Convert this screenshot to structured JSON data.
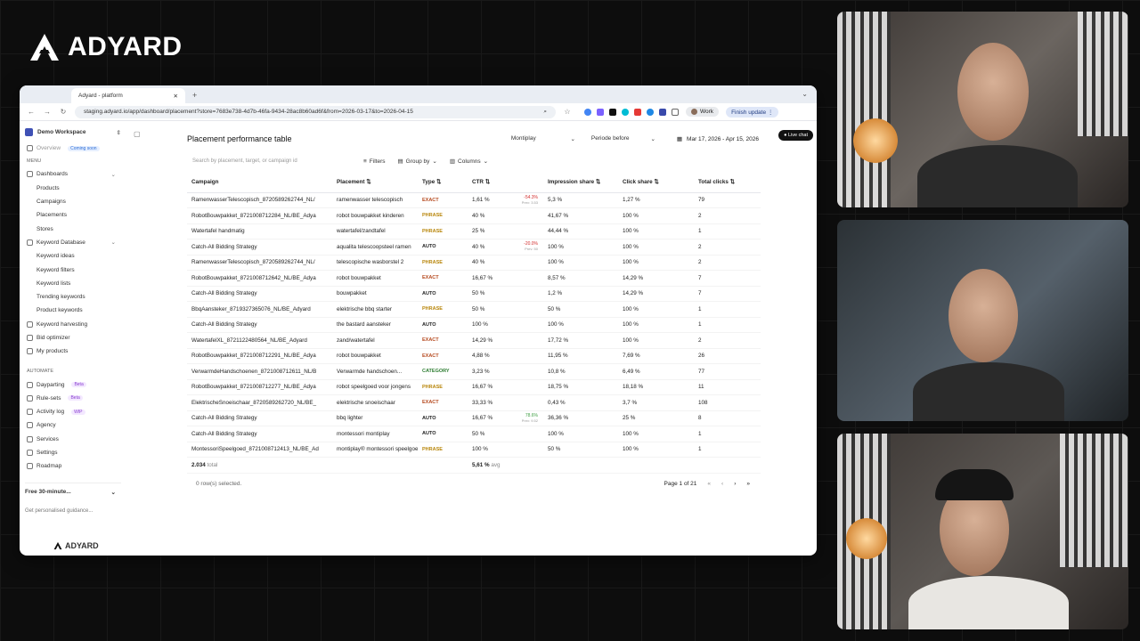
{
  "brand": {
    "name": "ADYARD"
  },
  "browser": {
    "tab_title": "Adyard - platform",
    "url": "staging.adyard.io/app/dashboard/placement?store=7683e738-4d7b-46fa-9434-28ac8b60ad6f&from=2026-03-17&to=2026-04-15",
    "profile_label": "Work",
    "finish_label": "Finish update"
  },
  "sidebar": {
    "workspace": "Demo Workspace",
    "overview": "Overview",
    "overview_badge": "Coming soon",
    "menu_title": "MENU",
    "dashboards": "Dashboards",
    "dashboard_items": [
      "Products",
      "Campaigns",
      "Placements",
      "Stores"
    ],
    "keyword_database": "Keyword Database",
    "keyword_items": [
      "Keyword ideas",
      "Keyword filters",
      "Keyword lists",
      "Trending keywords",
      "Product keywords"
    ],
    "keyword_harvesting": "Keyword harvesting",
    "bid_optimizer": "Bid optimizer",
    "my_products": "My products",
    "automate_title": "AUTOMATE",
    "dayparting": "Dayparting",
    "dayparting_badge": "Beta",
    "rule_sets": "Rule-sets",
    "rule_sets_badge": "Beta",
    "activity_log": "Activity log",
    "activity_badge": "WIP",
    "agency": "Agency",
    "services": "Services",
    "settings": "Settings",
    "roadmap": "Roadmap",
    "promo_title": "Free 30-minute...",
    "promo_sub": "Get personalised guidance...",
    "logo": "ADYARD"
  },
  "main": {
    "live_chat": "Live chat",
    "title": "Placement performance table",
    "store_select": "Montiplay",
    "compare_select": "Periode before",
    "date_range": "Mar 17, 2026 - Apr 15, 2026",
    "search_placeholder": "Search by placement, target, or campaign id",
    "filters": "Filters",
    "group_by": "Group by",
    "columns": "Columns",
    "headers": [
      "Campaign",
      "Placement",
      "Type",
      "CTR",
      "Impression share",
      "Click share",
      "Total clicks"
    ],
    "rows": [
      {
        "campaign": "RamenwasserTelescopisch_8720589262744_NL/",
        "placement": "ramenwasser telescopisch",
        "type": "EXACT",
        "ctr": "1,61 %",
        "delta": "-54.3%",
        "prev": "Prev: 3.53",
        "imp": "5,3 %",
        "click": "1,27 %",
        "clicks": "79"
      },
      {
        "campaign": "RobotBouwpakket_8721008712284_NL/BE_Adya",
        "placement": "robot bouwpakket kinderen",
        "type": "PHRASE",
        "ctr": "40 %",
        "imp": "41,67 %",
        "click": "100 %",
        "clicks": "2"
      },
      {
        "campaign": "Watertafel handmatig",
        "placement": "watertafel/zandtafel",
        "type": "PHRASE",
        "ctr": "25 %",
        "imp": "44,44 %",
        "click": "100 %",
        "clicks": "1"
      },
      {
        "campaign": "Catch-All Bidding Strategy",
        "placement": "aqualita telescoopsteel ramen",
        "type": "AUTO",
        "ctr": "40 %",
        "delta": "-20.0%",
        "prev": "Prev: 50",
        "imp": "100 %",
        "click": "100 %",
        "clicks": "2"
      },
      {
        "campaign": "RamenwasserTelescopisch_8720589262744_NL/",
        "placement": "telescopische wasborstel 2",
        "type": "PHRASE",
        "ctr": "40 %",
        "imp": "100 %",
        "click": "100 %",
        "clicks": "2"
      },
      {
        "campaign": "RobotBouwpakket_8721008712642_NL/BE_Adya",
        "placement": "robot bouwpakket",
        "type": "EXACT",
        "ctr": "16,67 %",
        "imp": "8,57 %",
        "click": "14,29 %",
        "clicks": "7"
      },
      {
        "campaign": "Catch-All Bidding Strategy",
        "placement": "bouwpakket",
        "type": "AUTO",
        "ctr": "50 %",
        "imp": "1,2 %",
        "click": "14,29 %",
        "clicks": "7"
      },
      {
        "campaign": "BbqAansteker_8719327365076_NL/BE_Adyard",
        "placement": "elektrische bbq starter",
        "type": "PHRASE",
        "ctr": "50 %",
        "imp": "50 %",
        "click": "100 %",
        "clicks": "1"
      },
      {
        "campaign": "Catch-All Bidding Strategy",
        "placement": "the bastard aansteker",
        "type": "AUTO",
        "ctr": "100 %",
        "imp": "100 %",
        "click": "100 %",
        "clicks": "1"
      },
      {
        "campaign": "WatertafelXL_8721122480564_NL/BE_Adyard",
        "placement": "zand/watertafel",
        "type": "EXACT",
        "ctr": "14,29 %",
        "imp": "17,72 %",
        "click": "100 %",
        "clicks": "2"
      },
      {
        "campaign": "RobotBouwpakket_8721008712291_NL/BE_Adya",
        "placement": "robot bouwpakket",
        "type": "EXACT",
        "ctr": "4,88 %",
        "imp": "11,95 %",
        "click": "7,69 %",
        "clicks": "26"
      },
      {
        "campaign": "VerwarmdeHandschoenen_8721008712611_NL/B",
        "placement": "Verwarmde handschoen...",
        "type": "CATEGORY",
        "ctr": "3,23 %",
        "imp": "10,8 %",
        "click": "6,49 %",
        "clicks": "77"
      },
      {
        "campaign": "RobotBouwpakket_8721008712277_NL/BE_Adya",
        "placement": "robot speelgoed voor jongens",
        "type": "PHRASE",
        "ctr": "16,67 %",
        "imp": "18,75 %",
        "click": "18,18 %",
        "clicks": "11"
      },
      {
        "campaign": "ElektrischeSnoeischaar_8720589262720_NL/BE_",
        "placement": "elektrische snoeischaar",
        "type": "EXACT",
        "ctr": "33,33 %",
        "imp": "0,43 %",
        "click": "3,7 %",
        "clicks": "108"
      },
      {
        "campaign": "Catch-All Bidding Strategy",
        "placement": "bbq lighter",
        "type": "AUTO",
        "ctr": "16,67 %",
        "delta": "78.6%",
        "prev": "Prev: 9.52",
        "imp": "36,36 %",
        "click": "25 %",
        "clicks": "8"
      },
      {
        "campaign": "Catch-All Bidding Strategy",
        "placement": "montessori montiplay",
        "type": "AUTO",
        "ctr": "50 %",
        "imp": "100 %",
        "click": "100 %",
        "clicks": "1"
      },
      {
        "campaign": "MontessoriSpeelgoed_8721008712413_NL/BE_Ad",
        "placement": "montiplay® montessori speelgoed",
        "type": "PHRASE",
        "ctr": "100 %",
        "imp": "50 %",
        "click": "100 %",
        "clicks": "1"
      }
    ],
    "total_value": "2.034",
    "total_label": "total",
    "avg_value": "5,61 %",
    "avg_label": "avg",
    "selected_text": "0 row(s) selected.",
    "page_text": "Page 1 of 21"
  }
}
